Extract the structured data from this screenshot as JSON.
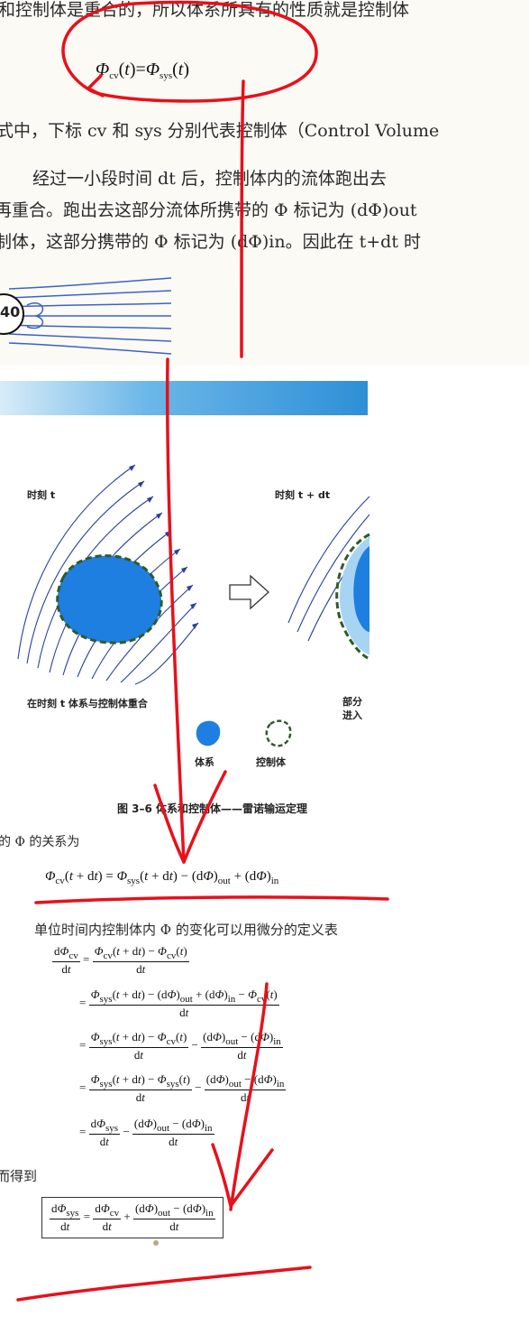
{
  "top": {
    "line1": "和控制体是重合的，所以体系所具有的性质就是控制体",
    "eq_top": "Φcv(t)=Φsys(t)",
    "line2": "式中，下标 cv 和 sys 分别代表控制体（Control Volume",
    "line3": "经过一小段时间 dt 后，控制体内的流体跑出去",
    "line4": "再重合。跑出去这部分流体所携带的 Φ 标记为 (dΦ)out",
    "line5": "制体，这部分携带的 Φ 标记为 (dΦ)in。因此在 t+dt 时",
    "badge": "40"
  },
  "figure": {
    "label_t": "时刻  t",
    "label_tdt": "时刻  t + dt",
    "caption_left": "在时刻 t 体系与控制体重合",
    "caption_right_1": "部分",
    "caption_right_2": "进入",
    "legend_system": "体系",
    "legend_cv": "控制体",
    "title": "图 3–6  体系和控制体——雷诺输运定理"
  },
  "body": {
    "text1": "的 Φ 的关系为",
    "eq1": "Φcv(t + dt) = Φsys(t + dt) − (dΦ)out + (dΦ)in",
    "text2": "单位时间内控制体内 Φ 的变化可以用微分的定义表",
    "text3": "而得到"
  },
  "colors": {
    "annotation_red": "#e8101a",
    "system_blue": "#1e7fe0",
    "stream_blue": "#2b3f9e",
    "cv_green": "#2f5a2a",
    "banner_blue": "#2e8fd6"
  }
}
